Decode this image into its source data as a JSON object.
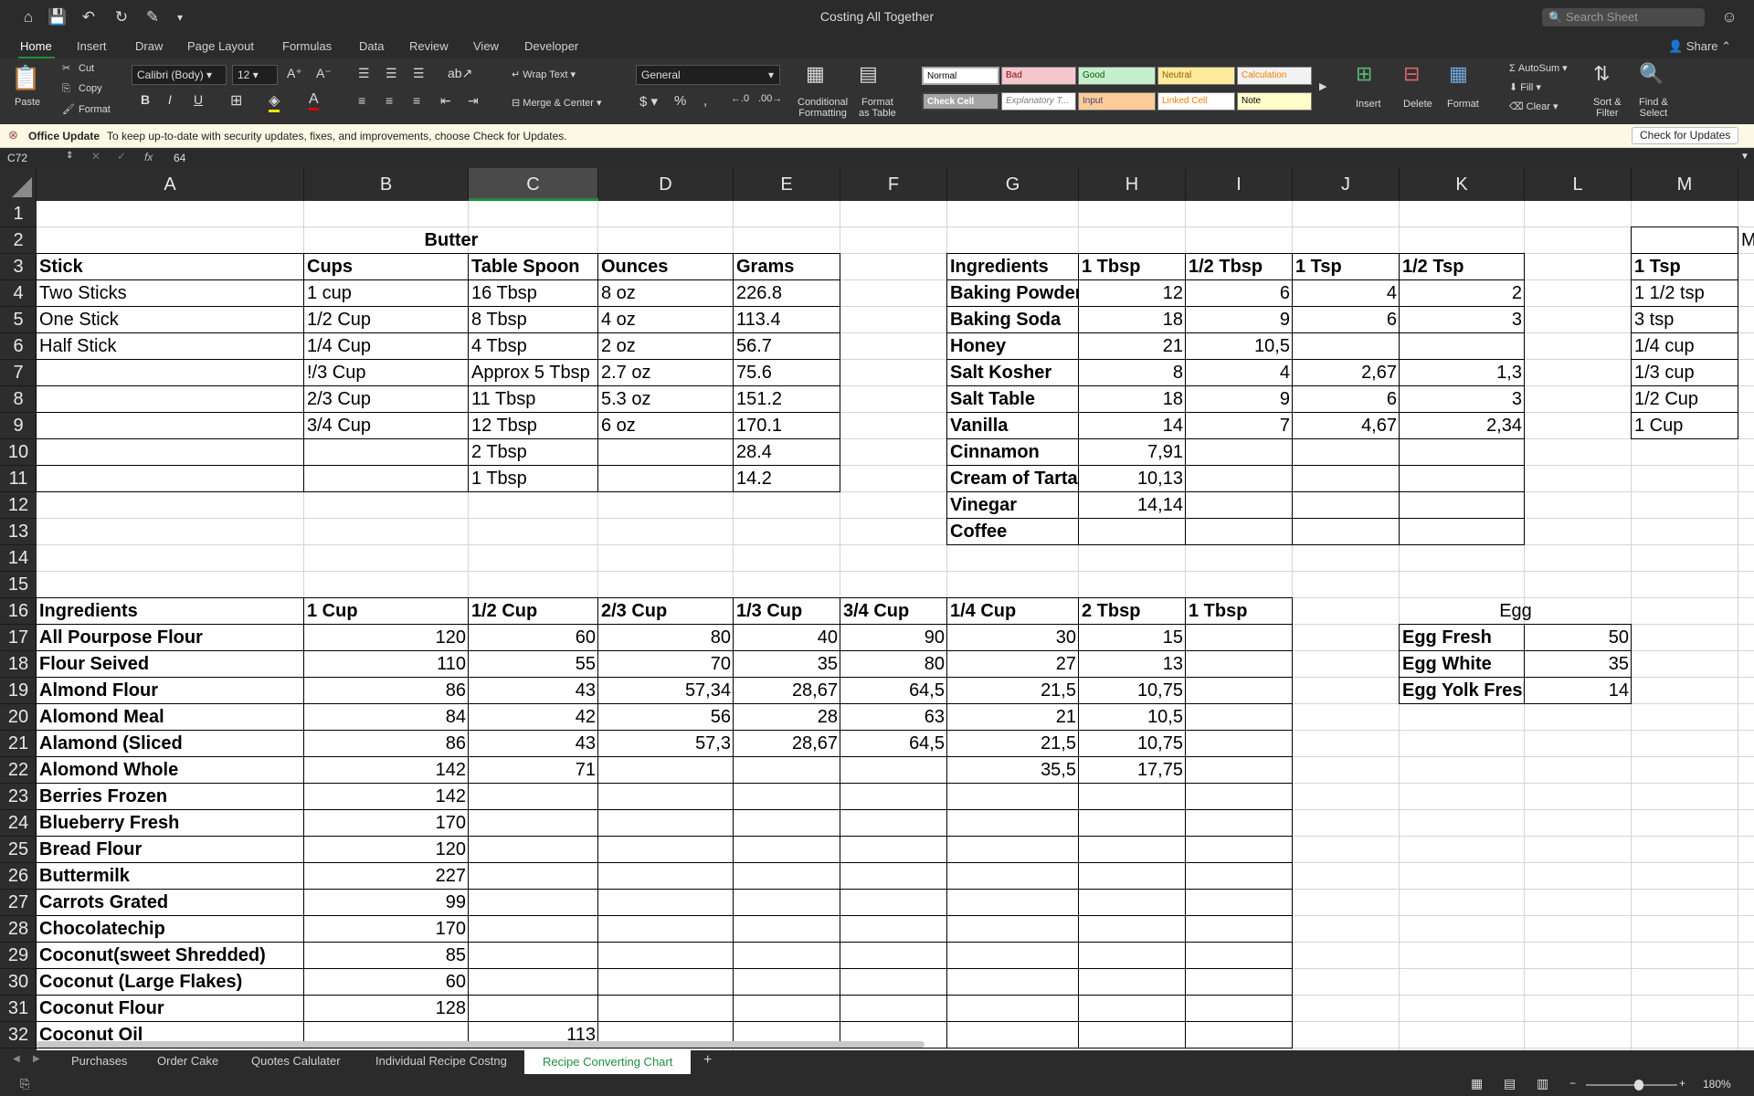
{
  "app": {
    "title": "Costing All Together",
    "search_placeholder": "Search Sheet"
  },
  "menu": {
    "tabs": [
      "Home",
      "Insert",
      "Draw",
      "Page Layout",
      "Formulas",
      "Data",
      "Review",
      "View",
      "Developer"
    ],
    "share": "Share"
  },
  "ribbon": {
    "paste": "Paste",
    "cut": "Cut",
    "copy": "Copy",
    "format_painter": "Format",
    "font_name": "Calibri (Body)",
    "font_size": "12",
    "wrap_text": "Wrap Text",
    "merge_center": "Merge & Center",
    "number_format": "General",
    "conditional_formatting_1": "Conditional",
    "conditional_formatting_2": "Formatting",
    "format_table_1": "Format",
    "format_table_2": "as Table",
    "styles": [
      "Normal",
      "Bad",
      "Good",
      "Neutral",
      "Calculation",
      "Check Cell",
      "Explanatory T...",
      "Input",
      "Linked Cell",
      "Note"
    ],
    "insert": "Insert",
    "delete": "Delete",
    "format": "Format",
    "autosum": "AutoSum",
    "fill": "Fill",
    "clear": "Clear",
    "sort_filter_1": "Sort &",
    "sort_filter_2": "Filter",
    "find_select_1": "Find &",
    "find_select_2": "Select",
    "colors": {
      "bad": "#f4c7ce",
      "good": "#c6efce",
      "neutral": "#ffeb9c",
      "input": "#fbcc99",
      "note": "#ffffcc",
      "check": "#a5a5a5"
    }
  },
  "update_bar": {
    "title": "Office Update",
    "message": "To keep up-to-date with security updates, fixes, and improvements, choose Check for Updates.",
    "button": "Check for Updates"
  },
  "formula_bar": {
    "name_box": "C72",
    "fx": "fx",
    "value": "64"
  },
  "columns": [
    "A",
    "B",
    "C",
    "D",
    "E",
    "F",
    "G",
    "H",
    "I",
    "J",
    "K",
    "L",
    "M"
  ],
  "rows": [
    "1",
    "2",
    "3",
    "4",
    "5",
    "6",
    "7",
    "8",
    "9",
    "10",
    "11",
    "12",
    "13",
    "14",
    "15",
    "16",
    "17",
    "18",
    "19",
    "20",
    "21",
    "22",
    "23",
    "24",
    "25",
    "26",
    "27",
    "28",
    "29",
    "30",
    "31",
    "32"
  ],
  "butter": {
    "title": "Butter",
    "headers": [
      "Stick",
      "Cups",
      "Table Spoon",
      "Ounces",
      "Grams"
    ],
    "rows": [
      [
        "Two Sticks",
        "1 cup",
        "16 Tbsp",
        "8 oz",
        "226.8"
      ],
      [
        "One Stick",
        "1/2 Cup",
        "8 Tbsp",
        "4 oz",
        "113.4"
      ],
      [
        "Half Stick",
        "1/4 Cup",
        "4 Tbsp",
        "2 oz",
        "56.7"
      ],
      [
        "",
        "!/3 Cup",
        "Approx 5 Tbsp",
        "2.7 oz",
        "75.6"
      ],
      [
        "",
        "2/3 Cup",
        "11 Tbsp",
        "5.3 oz",
        "151.2"
      ],
      [
        "",
        "3/4 Cup",
        "12 Tbsp",
        "6 oz",
        "170.1"
      ],
      [
        "",
        "",
        "2 Tbsp",
        "",
        "28.4"
      ],
      [
        "",
        "",
        "1 Tbsp",
        "",
        "14.2"
      ]
    ]
  },
  "spoons": {
    "headers": [
      "Ingredients",
      "1 Tbsp",
      "1/2 Tbsp",
      "1 Tsp",
      "1/2 Tsp"
    ],
    "rows": [
      [
        "Baking Powder",
        "12",
        "6",
        "4",
        "2"
      ],
      [
        "Baking Soda",
        "18",
        "9",
        "6",
        "3"
      ],
      [
        "Honey",
        "21",
        "10,5",
        "",
        ""
      ],
      [
        "Salt Kosher",
        "8",
        "4",
        "2,67",
        "1,3"
      ],
      [
        "Salt Table",
        "18",
        "9",
        "6",
        "3"
      ],
      [
        "Vanilla",
        "14",
        "7",
        "4,67",
        "2,34"
      ],
      [
        "Cinnamon",
        "7,91",
        "",
        "",
        ""
      ],
      [
        "Cream of Tarta",
        "10,13",
        "",
        "",
        ""
      ],
      [
        "Vinegar",
        "14,14",
        "",
        "",
        ""
      ],
      [
        "Coffee",
        "",
        "",
        "",
        ""
      ]
    ]
  },
  "measure": {
    "partial_header": "M",
    "rows": [
      "1 Tsp",
      "1 1/2 tsp",
      "3 tsp",
      "1/4 cup",
      "1/3 cup",
      "1/2 Cup",
      "1 Cup"
    ]
  },
  "cups": {
    "headers": [
      "Ingredients",
      "1 Cup",
      "1/2 Cup",
      "2/3 Cup",
      "1/3 Cup",
      "3/4 Cup",
      "1/4 Cup",
      "2 Tbsp",
      "1 Tbsp"
    ],
    "rows": [
      [
        "All Pourpose Flour",
        "120",
        "60",
        "80",
        "40",
        "90",
        "30",
        "15",
        ""
      ],
      [
        "Flour Seived",
        "110",
        "55",
        "70",
        "35",
        "80",
        "27",
        "13",
        ""
      ],
      [
        "Almond Flour",
        "86",
        "43",
        "57,34",
        "28,67",
        "64,5",
        "21,5",
        "10,75",
        ""
      ],
      [
        "Alomond Meal",
        "84",
        "42",
        "56",
        "28",
        "63",
        "21",
        "10,5",
        ""
      ],
      [
        "Alamond (Sliced",
        "86",
        "43",
        "57,3",
        "28,67",
        "64,5",
        "21,5",
        "10,75",
        ""
      ],
      [
        "Alomond Whole",
        "142",
        "71",
        "",
        "",
        "",
        "35,5",
        "17,75",
        ""
      ],
      [
        "Berries Frozen",
        "142",
        "",
        "",
        "",
        "",
        "",
        "",
        ""
      ],
      [
        "Blueberry Fresh",
        "170",
        "",
        "",
        "",
        "",
        "",
        "",
        ""
      ],
      [
        "Bread Flour",
        "120",
        "",
        "",
        "",
        "",
        "",
        "",
        ""
      ],
      [
        "Buttermilk",
        "227",
        "",
        "",
        "",
        "",
        "",
        "",
        ""
      ],
      [
        "Carrots Grated",
        "99",
        "",
        "",
        "",
        "",
        "",
        "",
        ""
      ],
      [
        "Chocolatechip",
        "170",
        "",
        "",
        "",
        "",
        "",
        "",
        ""
      ],
      [
        "Coconut(sweet Shredded)",
        "85",
        "",
        "",
        "",
        "",
        "",
        "",
        ""
      ],
      [
        "Coconut (Large Flakes)",
        "60",
        "",
        "",
        "",
        "",
        "",
        "",
        ""
      ],
      [
        "Coconut Flour",
        "128",
        "",
        "",
        "",
        "",
        "",
        "",
        ""
      ],
      [
        "Coconut Oil",
        "",
        "113",
        "",
        "",
        "",
        "",
        "",
        ""
      ]
    ]
  },
  "egg": {
    "title": "Egg",
    "rows": [
      [
        "Egg Fresh",
        "50"
      ],
      [
        "Egg White",
        "35"
      ],
      [
        "Egg Yolk Fresh",
        "14"
      ]
    ]
  },
  "sheets": [
    "Purchases",
    "Order Cake",
    "Quotes Calulater",
    "Individual Recipe Costng",
    "Recipe Converting Chart"
  ],
  "status": {
    "zoom": "180%"
  }
}
